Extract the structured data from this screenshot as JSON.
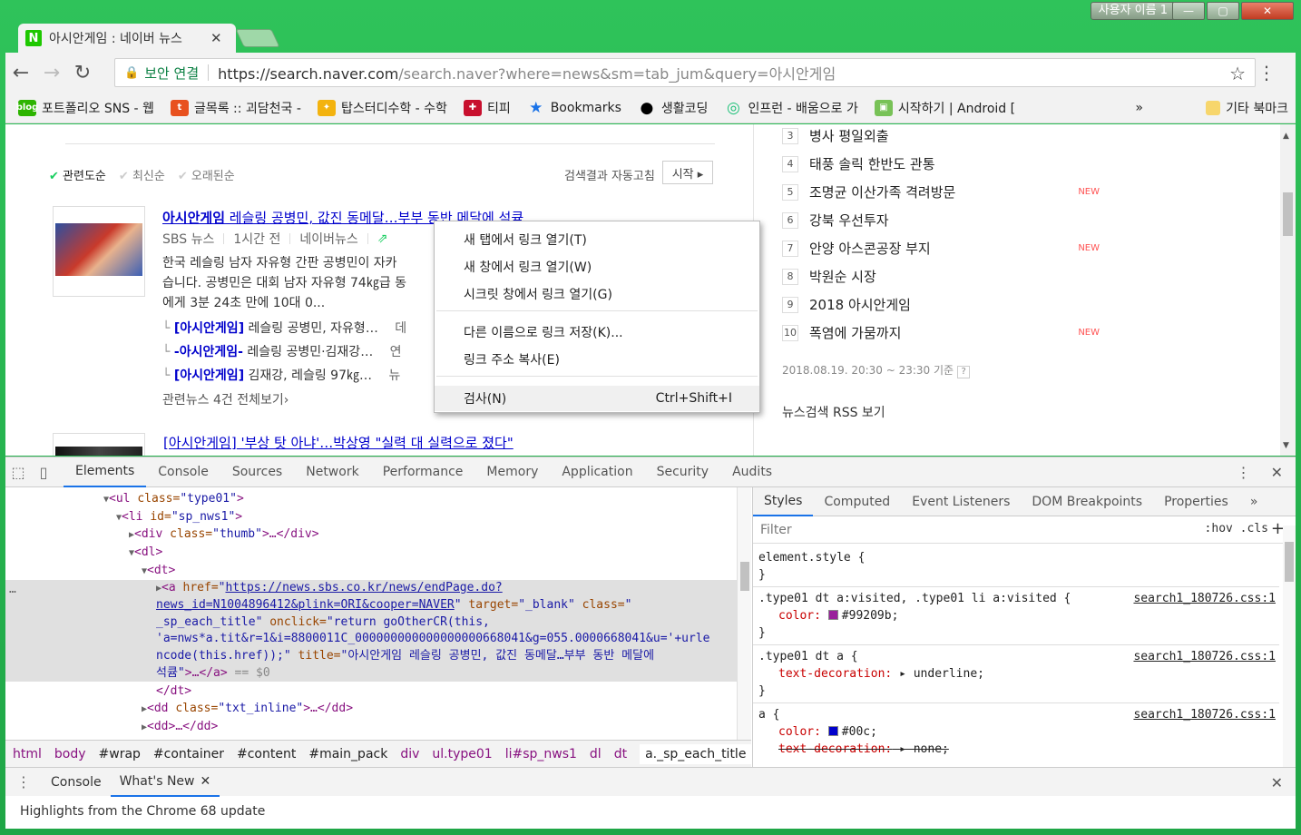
{
  "window": {
    "user_badge": "사용자 이름 1",
    "min": "—",
    "max": "▢",
    "close": "✕"
  },
  "tab": {
    "favicon": "N",
    "title": "아시안게임 : 네이버 뉴스",
    "close": "✕"
  },
  "toolbar": {
    "back": "←",
    "forward": "→",
    "reload": "↻",
    "secure_label": "보안 연결",
    "url_host": "https://search.naver.com",
    "url_path": "/search.naver?where=news&sm=tab_jum&query=아시안게임",
    "star": "☆",
    "menu": "⋮"
  },
  "bookmarks": [
    {
      "label": "포트폴리오 SNS - 웹",
      "icon": "blog-icon",
      "color": "#2db400",
      "glyph": "blog"
    },
    {
      "label": "글목록 :: 괴담천국 -",
      "icon": "tistory-icon",
      "color": "#e8511f",
      "glyph": "t"
    },
    {
      "label": "탑스터디수학 - 수학",
      "icon": "bird-icon",
      "color": "#f3b30f",
      "glyph": "✦"
    },
    {
      "label": "티피",
      "icon": "crest-icon",
      "color": "#c8102e",
      "glyph": "✚"
    },
    {
      "label": "Bookmarks",
      "icon": "star-icon",
      "color": "#1a73e8",
      "glyph": "★"
    },
    {
      "label": "생활코딩",
      "icon": "circle-icon",
      "color": "#000000",
      "glyph": "●"
    },
    {
      "label": "인프런 - 배움으로 가",
      "icon": "inflearn-icon",
      "color": "#1dc078",
      "glyph": "◎"
    },
    {
      "label": "시작하기 | Android [",
      "icon": "android-icon",
      "color": "#78c257",
      "glyph": "▣"
    }
  ],
  "bookmarks_more": "»",
  "bookmarks_other": "기타 북마크",
  "sort": {
    "relevance": "관련도순",
    "latest": "최신순",
    "oldest": "오래된순",
    "autofix": "검색결과 자동고침",
    "start": "시작 ▸"
  },
  "news1": {
    "title_hl": "아시안게임",
    "title_rest": " 레슬링 공병민, 값진 동메달…부부 동반 메달에 석큠",
    "source": "SBS 뉴스",
    "time": "1시간 전",
    "portal": "네이버뉴스",
    "desc1": "한국 레슬링 남자 자유형 간판 공병민이 자카",
    "desc2": "습니다. 공병민은 대회 남자 자유형 74㎏급 동",
    "desc3": "에게 3분 24초 만에 10대 0...",
    "related": [
      {
        "hl": "[아시안게임]",
        "rest": " 레슬링 공병민, 자유형…",
        "src": "데"
      },
      {
        "hl": "-아시안게임-",
        "rest": " 레슬링 공병민·김재강…",
        "src": "연"
      },
      {
        "hl": "[아시안게임]",
        "rest": " 김재강, 레슬링 97㎏…",
        "src": "뉴"
      }
    ],
    "related_more": "관련뉴스 4건 전체보기›"
  },
  "news2": {
    "title_hl": "[아시안게임]",
    "title_rest": " '부상 탓 아냐'…박상영 \"실력 대 실력으로 졌다\""
  },
  "ranking": [
    {
      "num": "3",
      "label": "병사 평일외출",
      "new": ""
    },
    {
      "num": "4",
      "label": "태풍 솔릭 한반도 관통",
      "new": ""
    },
    {
      "num": "5",
      "label": "조명균 이산가족 격려방문",
      "new": "NEW"
    },
    {
      "num": "6",
      "label": "강북 우선투자",
      "new": ""
    },
    {
      "num": "7",
      "label": "안양 아스콘공장 부지",
      "new": "NEW"
    },
    {
      "num": "8",
      "label": "박원순 시장",
      "new": ""
    },
    {
      "num": "9",
      "label": "2018 아시안게임",
      "new": ""
    },
    {
      "num": "10",
      "label": "폭염에 가뭄까지",
      "new": "NEW"
    }
  ],
  "ranking_stamp": "2018.08.19. 20:30 ~ 23:30 기준",
  "ranking_help": "?",
  "rss": "뉴스검색 RSS 보기",
  "context_menu": [
    {
      "label": "새 탭에서 링크 열기(T)",
      "shortcut": ""
    },
    {
      "label": "새 창에서 링크 열기(W)",
      "shortcut": ""
    },
    {
      "label": "시크릿 창에서 링크 열기(G)",
      "shortcut": ""
    },
    {
      "label": "다른 이름으로 링크 저장(K)...",
      "shortcut": ""
    },
    {
      "label": "링크 주소 복사(E)",
      "shortcut": ""
    },
    {
      "label": "검사(N)",
      "shortcut": "Ctrl+Shift+I"
    }
  ],
  "devtools": {
    "tabs": [
      "Elements",
      "Console",
      "Sources",
      "Network",
      "Performance",
      "Memory",
      "Application",
      "Security",
      "Audits"
    ],
    "active_tab": "Elements",
    "dom": {
      "l1_tag": "<ul",
      "l1_attr": " class=",
      "l1_val": "\"type01\"",
      "l1_end": ">",
      "l2_tag": "<li",
      "l2_attr": " id=",
      "l2_val": "\"sp_nws1\"",
      "l2_end": ">",
      "l3_tag": "<div",
      "l3_attr": " class=",
      "l3_val": "\"thumb\"",
      "l3_end": ">…</div>",
      "l4": "<dl>",
      "l5": "<dt>",
      "a_open": "<a",
      "a_href_attr": " href=",
      "a_href1": "https://news.sbs.co.kr/news/endPage.do?",
      "a_href2": "news_id=N1004896412&plink=ORI&cooper=NAVER",
      "a_target_attr": " target=",
      "a_target_val": "\"_blank\"",
      "a_class_attr": " class=",
      "a_class_q": "\"",
      "a_class_val": "_sp_each_title\"",
      "a_onclick_attr": " onclick=",
      "a_onclick1": "\"return goOtherCR(this,",
      "a_onclick2": "'a=nws*a.tit&r=1&i=8800011C_000000000000000000668041&g=055.0000668041&u='+urle",
      "a_onclick3": "ncode(this.href));\"",
      "a_title_attr": " title=",
      "a_title_val": "\"아시안게임 레슬링 공병민, 값진 동메달…부부 동반 메달에",
      "a_title_val2": "석큠\"",
      "a_close": ">…</a>",
      "a_eq": " == $0",
      "l_dt_close": "</dt>",
      "l_dd1_tag": "<dd",
      "l_dd1_attr": " class=",
      "l_dd1_val": "\"txt_inline\"",
      "l_dd1_end": ">…</dd>",
      "l_dd2": "<dd>…</dd>",
      "ellipsis": "…"
    },
    "breadcrumbs": [
      "html",
      "body",
      "#wrap",
      "#container",
      "#content",
      "#main_pack",
      "div",
      "ul.type01",
      "li#sp_nws1",
      "dl",
      "dt",
      "a._sp_each_title"
    ],
    "style_tabs": [
      "Styles",
      "Computed",
      "Event Listeners",
      "DOM Breakpoints",
      "Properties"
    ],
    "style_more": "»",
    "filter_placeholder": "Filter",
    "hov_cls": ":hov  .cls",
    "plus": "+",
    "rules": [
      {
        "selector": "element.style {",
        "src": "",
        "props": [],
        "close": "}"
      },
      {
        "selector": ".type01 dt a:visited, .type01 li a:visited {",
        "src": "search1_180726.css:1",
        "props": [
          {
            "name": "color:",
            "value": "#99209b;",
            "swatch": "#99209b",
            "struck": false
          }
        ],
        "close": "}"
      },
      {
        "selector": ".type01 dt a {",
        "src": "search1_180726.css:1",
        "props": [
          {
            "name": "text-decoration:",
            "value": "▸ underline;",
            "swatch": "",
            "struck": false
          }
        ],
        "close": "}"
      },
      {
        "selector": "a {",
        "src": "search1_180726.css:1",
        "props": [
          {
            "name": "color:",
            "value": "#00c;",
            "swatch": "#0000cc",
            "struck": false
          },
          {
            "name": "text-decoration:",
            "value": "▸ none;",
            "swatch": "",
            "struck": true
          }
        ],
        "close": ""
      }
    ],
    "drawer_tabs": [
      "Console",
      "What's New"
    ],
    "drawer_close": "✕",
    "highlights": "Highlights from the Chrome 68 update"
  }
}
